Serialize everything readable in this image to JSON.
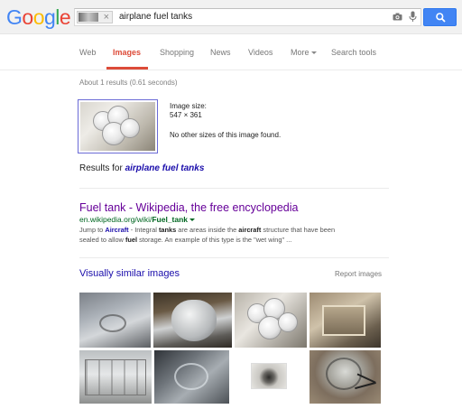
{
  "header": {
    "logo": "Google",
    "search_query": "airplane fuel tanks",
    "image_chip_close": "×",
    "colors": {
      "logo_blue": "#4285f4",
      "logo_red": "#ea4335",
      "logo_yellow": "#fbbc05",
      "logo_green": "#34a853",
      "search_button": "#4285f4"
    },
    "icons": [
      "camera-icon",
      "microphone-icon",
      "search-icon"
    ]
  },
  "tabs": [
    {
      "label": "Web"
    },
    {
      "label": "Images",
      "active": true
    },
    {
      "label": "Shopping"
    },
    {
      "label": "News"
    },
    {
      "label": "Videos"
    },
    {
      "label": "More"
    },
    {
      "label": "Search tools"
    }
  ],
  "results": {
    "stats": "About 1 results (0.61 seconds)",
    "image_size_label": "Image size:",
    "image_size_value": "547 × 361",
    "other_sizes": "No other sizes of this image found.",
    "results_for_prefix": "Results for",
    "results_for_query": "airplane fuel tanks",
    "wiki": {
      "title": "Fuel tank - Wikipedia, the free encyclopedia",
      "url_prefix": "en.wikipedia.org/wiki/",
      "url_bold": "Fuel_tank",
      "snippet_jump": "Jump to",
      "snippet_link": "Aircraft",
      "snippet_line1_a": " - Integral ",
      "snippet_line1_b": "tanks",
      "snippet_line1_c": " are areas inside the ",
      "snippet_line1_d": "aircraft",
      "snippet_line1_e": " structure that have been",
      "snippet_line2_a": "sealed to allow ",
      "snippet_line2_b": "fuel",
      "snippet_line2_c": " storage. An example of this type is the \"wet wing\" ..."
    },
    "visually_similar_title": "Visually similar images",
    "report_images": "Report images"
  }
}
